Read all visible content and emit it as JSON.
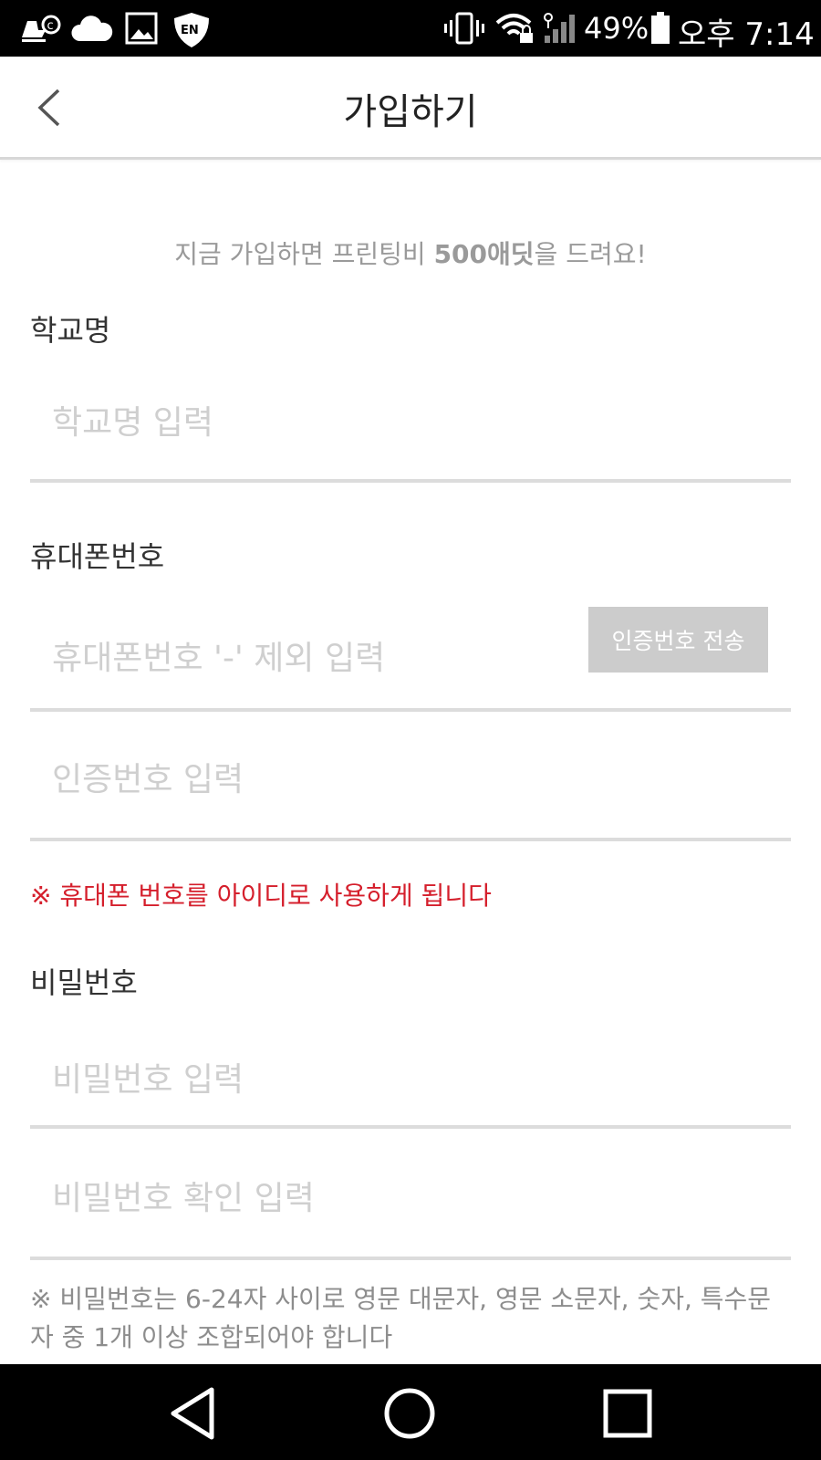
{
  "status_bar": {
    "battery": "49%",
    "time": "오후 7:14",
    "icons": [
      "notification-icon",
      "cloud-icon",
      "image-icon",
      "vpn-shield-icon",
      "vibrate-icon",
      "wifi-lock-icon",
      "signal-icon",
      "battery-icon"
    ],
    "vpn_badge": "EN"
  },
  "header": {
    "title": "가입하기"
  },
  "form": {
    "promo_prefix": "지금 가입하면 프린팅비 ",
    "promo_highlight": "500애딧",
    "promo_suffix": "을 드려요!",
    "school_label": "학교명",
    "school_placeholder": "학교명 입력",
    "phone_label": "휴대폰번호",
    "phone_placeholder": "휴대폰번호 '-' 제외 입력",
    "send_code_label": "인증번호 전송",
    "code_placeholder": "인증번호 입력",
    "phone_notice": "※ 휴대폰 번호를 아이디로 사용하게 됩니다",
    "password_label": "비밀번호",
    "password_placeholder": "비밀번호 입력",
    "password_confirm_placeholder": "비밀번호 확인 입력",
    "password_rule": "※ 비밀번호는 6-24자 사이로 영문 대문자, 영문 소문자, 숫자, 특수문자 중 1개 이상 조합되어야 합니다"
  },
  "colors": {
    "accent_red": "#d51f2c",
    "button_gray": "#cccccc"
  }
}
